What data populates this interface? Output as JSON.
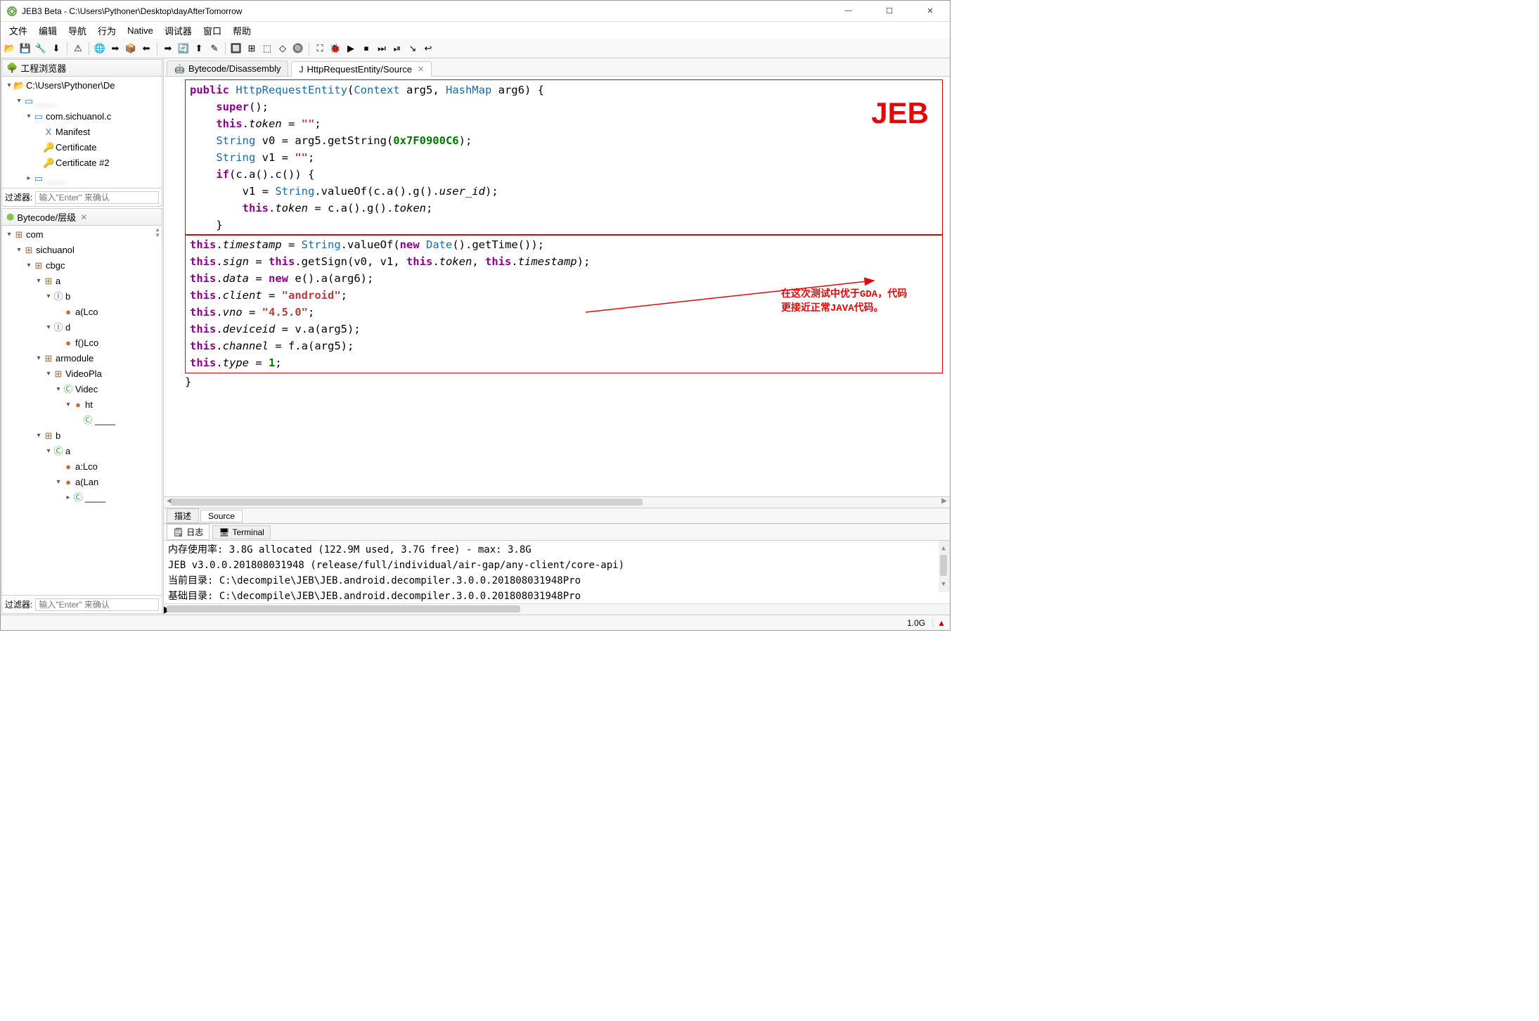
{
  "window": {
    "title": "JEB3 Beta - C:\\Users\\Pythoner\\Desktop\\dayAfterTomorrow",
    "minimize": "—",
    "maximize": "☐",
    "close": "✕"
  },
  "menubar": [
    "文件",
    "编辑",
    "导航",
    "行为",
    "Native",
    "调试器",
    "窗口",
    "帮助"
  ],
  "toolbar_icons": [
    "📂",
    "💾",
    "🔧",
    "⬇",
    "⚠",
    "🌐",
    "➡",
    "📦",
    "⬅",
    "➡",
    "🔄",
    "⬆",
    "✎",
    "🔲",
    "⊞",
    "⬚",
    "◇",
    "🔘",
    "⛶",
    "🐞",
    "▶",
    "⏹",
    "⏭",
    "⏯",
    "↘",
    "↩"
  ],
  "left": {
    "project_panel_title": "工程浏览器",
    "filter_label": "过滤器:",
    "filter_placeholder": "输入\"Enter\" 来确认",
    "project_tree": [
      {
        "indent": 0,
        "caret": "▾",
        "icon": "📂",
        "iconClass": "ic-folder",
        "label": "C:\\Users\\Pythoner\\De"
      },
      {
        "indent": 1,
        "caret": "▾",
        "icon": "▭",
        "iconClass": "ic-file",
        "label": "",
        "blur": true
      },
      {
        "indent": 2,
        "caret": "▾",
        "icon": "▭",
        "iconClass": "ic-file",
        "label": "com.sichuanol.c"
      },
      {
        "indent": 3,
        "caret": " ",
        "icon": "X",
        "iconClass": "ic-file",
        "label": "Manifest"
      },
      {
        "indent": 3,
        "caret": " ",
        "icon": "🔑",
        "iconClass": "ic-key",
        "label": "Certificate"
      },
      {
        "indent": 3,
        "caret": " ",
        "icon": "🔑",
        "iconClass": "ic-key",
        "label": "Certificate #2"
      },
      {
        "indent": 2,
        "caret": "▸",
        "icon": "▭",
        "iconClass": "ic-file",
        "label": "",
        "blur": true
      }
    ],
    "bytecode_panel_title": "Bytecode/层级",
    "bytecode_tree": [
      {
        "indent": 0,
        "caret": "▾",
        "icon": "⊞",
        "iconClass": "ic-pkg",
        "label": "com"
      },
      {
        "indent": 1,
        "caret": "▾",
        "icon": "⊞",
        "iconClass": "ic-pkg",
        "label": "sichuanol"
      },
      {
        "indent": 2,
        "caret": "▾",
        "icon": "⊞",
        "iconClass": "ic-pkg",
        "label": "cbgc"
      },
      {
        "indent": 3,
        "caret": "▾",
        "icon": "⊞",
        "iconClass": "ic-pkg",
        "label": "a"
      },
      {
        "indent": 4,
        "caret": "▾",
        "icon": "Ⓘ",
        "iconClass": "ic-field",
        "label": "b"
      },
      {
        "indent": 5,
        "caret": " ",
        "icon": "●",
        "iconClass": "ic-method",
        "label": "a(Lco"
      },
      {
        "indent": 4,
        "caret": "▾",
        "icon": "Ⓘ",
        "iconClass": "ic-field",
        "label": "d"
      },
      {
        "indent": 5,
        "caret": " ",
        "icon": "●",
        "iconClass": "ic-method",
        "label": "f()Lco"
      },
      {
        "indent": 3,
        "caret": "▾",
        "icon": "⊞",
        "iconClass": "ic-pkg",
        "label": "armodule"
      },
      {
        "indent": 4,
        "caret": "▾",
        "icon": "⊞",
        "iconClass": "ic-pkg",
        "label": "VideoPla"
      },
      {
        "indent": 5,
        "caret": "▾",
        "icon": "Ⓒ",
        "iconClass": "ic-class",
        "label": "Videc"
      },
      {
        "indent": 6,
        "caret": "▾",
        "icon": "●",
        "iconClass": "ic-method",
        "label": "ht"
      },
      {
        "indent": 7,
        "caret": " ",
        "icon": "Ⓒ",
        "iconClass": "ic-class",
        "label": ""
      },
      {
        "indent": 3,
        "caret": "▾",
        "icon": "⊞",
        "iconClass": "ic-pkg",
        "label": "b"
      },
      {
        "indent": 4,
        "caret": "▾",
        "icon": "Ⓒ",
        "iconClass": "ic-class",
        "label": "a"
      },
      {
        "indent": 5,
        "caret": " ",
        "icon": "●",
        "iconClass": "ic-method",
        "label": "a:Lco"
      },
      {
        "indent": 5,
        "caret": "▾",
        "icon": "●",
        "iconClass": "ic-method",
        "label": "a(Lan"
      },
      {
        "indent": 6,
        "caret": "▸",
        "icon": "Ⓒ",
        "iconClass": "ic-class",
        "label": ""
      }
    ]
  },
  "editor": {
    "tabs": [
      {
        "icon": "🤖",
        "label": "Bytecode/Disassembly",
        "active": false
      },
      {
        "icon": "J",
        "label": "HttpRequestEntity/Source",
        "active": true
      }
    ],
    "bottom_tabs": [
      {
        "label": "描述",
        "active": false
      },
      {
        "label": "Source",
        "active": true
      }
    ],
    "annot_logo": "JEB",
    "annot_text_l1": "在这次测试中优于GDA，代码",
    "annot_text_l2": "更接近正常JAVA代码。"
  },
  "code": {
    "sig_public": "public",
    "sig_name": "HttpRequestEntity",
    "sig_ctx": "Context",
    "sig_arg5": " arg5, ",
    "sig_hmap": "HashMap",
    "sig_arg6": " arg6) {",
    "super": "super",
    "this": "this",
    "tok": "token",
    "eq_empty": " = ",
    "empty": "\"\"",
    "string": "String",
    "v0": " v0 = arg5.getString(",
    "hex": "0x7F0900C6",
    "close": ");",
    "v1": " v1 = ",
    "if": "if",
    "ifcond": "(c.a().c()) {",
    "v1assign": "v1 = ",
    "valueof": ".valueOf(c.a().g().",
    "userid": "user_id",
    "tokenassign": " = c.a().g().",
    "ts": "timestamp",
    "ts_val": ".valueOf(",
    "new": "new",
    "date": "Date",
    "gettime": "().getTime());",
    "sign": "sign",
    "getsign": ".getSign(v0, v1, ",
    "comma": ", ",
    "data": "data",
    "neweq": " = ",
    "newe": " e().a(arg6);",
    "client": "client",
    "android": "\"android\"",
    "vno": "vno",
    "v450": "\"4.5.0\"",
    "deviceid": "deviceid",
    "va": " = v.a(arg5);",
    "channel": "channel",
    "fa": " = f.a(arg5);",
    "type": "type",
    "one": "1"
  },
  "log": {
    "tab_log": "日志",
    "tab_term": "Terminal",
    "lines": [
      "内存使用率: 3.8G allocated (122.9M used, 3.7G free) - max: 3.8G",
      "JEB v3.0.0.201808031948 (release/full/individual/air-gap/any-client/core-api)",
      "当前目录: C:\\decompile\\JEB\\JEB.android.decompiler.3.0.0.201808031948Pro",
      "基础目录: C:\\decompile\\JEB\\JEB.android.decompiler.3.0.0.201808031948Pro"
    ]
  },
  "statusbar": {
    "mem": "1.0G"
  }
}
